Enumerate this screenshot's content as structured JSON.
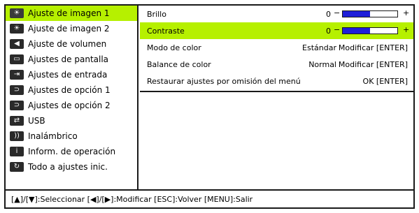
{
  "sidebar": {
    "items": [
      {
        "label": "Ajuste de imagen 1",
        "icon": "image-adjust-icon",
        "glyph": "☀"
      },
      {
        "label": "Ajuste de imagen 2",
        "icon": "image-adjust-icon",
        "glyph": "☀"
      },
      {
        "label": "Ajuste de volumen",
        "icon": "speaker-icon",
        "glyph": "◀"
      },
      {
        "label": "Ajustes de pantalla",
        "icon": "screen-icon",
        "glyph": "▭"
      },
      {
        "label": "Ajustes de entrada",
        "icon": "input-icon",
        "glyph": "⇥"
      },
      {
        "label": "Ajustes de opción 1",
        "icon": "option-icon",
        "glyph": "⊃"
      },
      {
        "label": "Ajustes de opción 2",
        "icon": "option-icon",
        "glyph": "⊃"
      },
      {
        "label": "USB",
        "icon": "usb-icon",
        "glyph": "⇄"
      },
      {
        "label": "Inalámbrico",
        "icon": "wireless-icon",
        "glyph": "))"
      },
      {
        "label": "Inform. de operación",
        "icon": "info-icon",
        "glyph": "i"
      },
      {
        "label": "Todo a ajustes inic.",
        "icon": "reset-icon",
        "glyph": "↻"
      }
    ]
  },
  "panel": {
    "brillo": {
      "label": "Brillo",
      "value": "0",
      "level": 0.5
    },
    "contraste": {
      "label": "Contraste",
      "value": "0",
      "level": 0.5
    },
    "modo_color": {
      "label": "Modo de color",
      "value": "Estándar",
      "action": "Modificar [ENTER]"
    },
    "balance_color": {
      "label": "Balance de color",
      "value": "Normal",
      "action": "Modificar [ENTER]"
    },
    "restaurar": {
      "label": "Restaurar ajustes por omisión del menú",
      "action": "OK [ENTER]"
    },
    "slider_minus": "−",
    "slider_plus": "+"
  },
  "footer": {
    "text": "[▲]/[▼]:Seleccionar  [◀]/[▶]:Modificar  [ESC]:Volver  [MENU]:Salir"
  },
  "colors": {
    "highlight": "#b6f000",
    "slider_fill": "#1f1fd8",
    "icon_bg": "#2a2a2a"
  }
}
